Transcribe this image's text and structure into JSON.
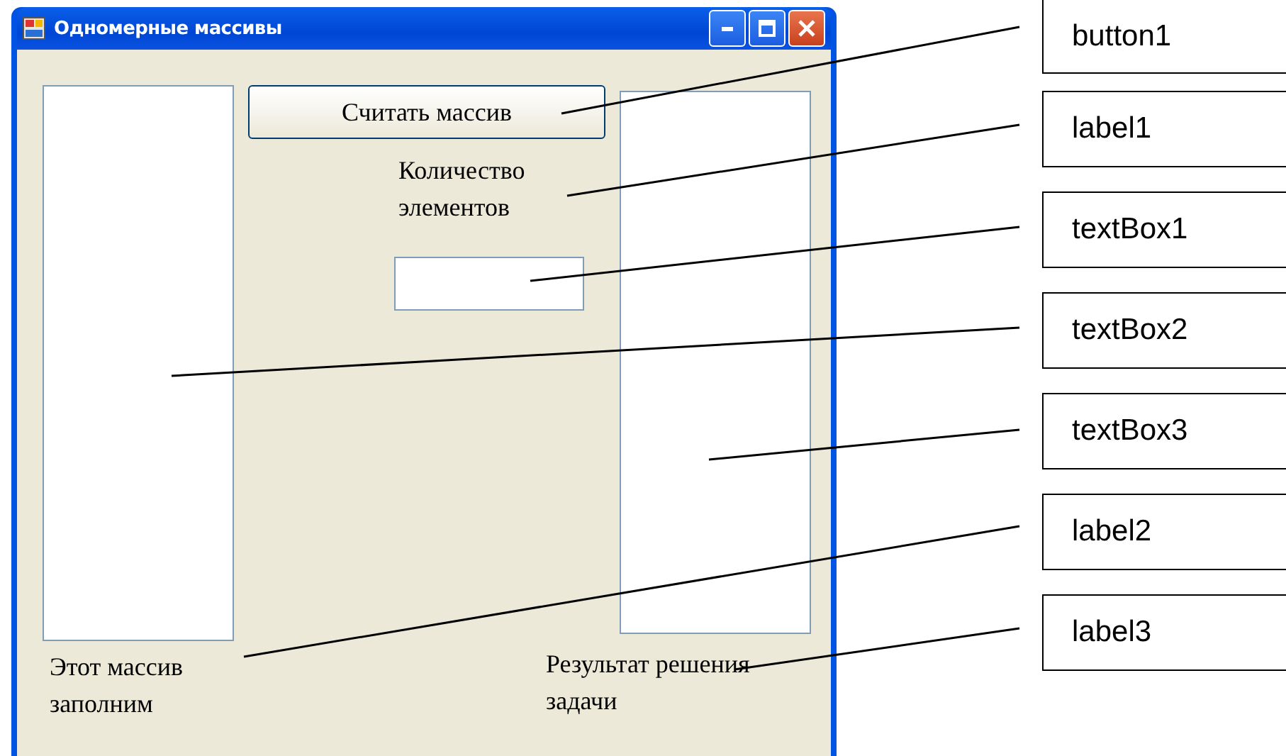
{
  "window": {
    "title": "Одномерные массивы"
  },
  "form": {
    "button": "Считать массив",
    "count_label": "Количество элементов",
    "source_label": "Этот массив заполним",
    "result_label": "Результат решения задачи"
  },
  "callouts": [
    {
      "label": "button1"
    },
    {
      "label": "label1"
    },
    {
      "label": "textBox1"
    },
    {
      "label": "textBox2"
    },
    {
      "label": "textBox3"
    },
    {
      "label": "label2"
    },
    {
      "label": "label3"
    }
  ]
}
